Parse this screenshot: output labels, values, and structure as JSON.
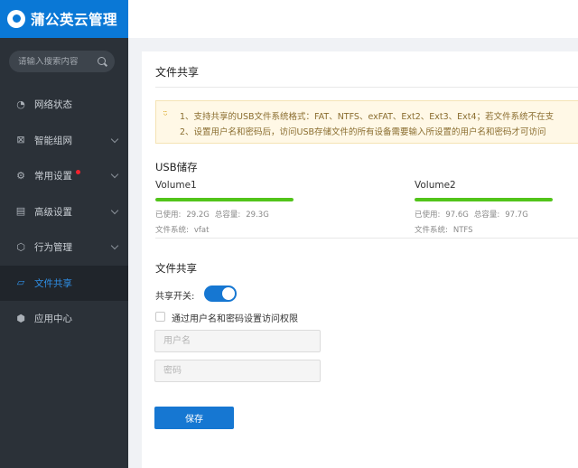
{
  "brand": {
    "title": "蒲公英云管理"
  },
  "search": {
    "placeholder": "请输入搜索内容"
  },
  "sidebar": {
    "items": [
      {
        "label": "网络状态",
        "icon": "gauge-icon"
      },
      {
        "label": "智能组网",
        "icon": "network-icon"
      },
      {
        "label": "常用设置",
        "icon": "gear-icon"
      },
      {
        "label": "高级设置",
        "icon": "document-icon"
      },
      {
        "label": "行为管理",
        "icon": "behavior-icon"
      },
      {
        "label": "文件共享",
        "icon": "folder-icon"
      },
      {
        "label": "应用中心",
        "icon": "cube-icon"
      }
    ]
  },
  "page": {
    "title": "文件共享"
  },
  "notice": {
    "line1": "1、支持共享的USB文件系统格式：FAT、NTFS、exFAT、Ext2、Ext3、Ext4；若文件系统不在支",
    "line2": "2、设置用户名和密码后，访问USB存储文件的所有设备需要输入所设置的用户名和密码才可访问"
  },
  "usb": {
    "title": "USB储存",
    "volumes": [
      {
        "name": "Volume1",
        "used_label": "已使用:",
        "used": "29.2G",
        "total_label": "总容量:",
        "total": "29.3G",
        "fs_label": "文件系统:",
        "fs": "vfat",
        "usage": 0.997
      },
      {
        "name": "Volume2",
        "used_label": "已使用:",
        "used": "97.6G",
        "total_label": "总容量:",
        "total": "97.7G",
        "fs_label": "文件系统:",
        "fs": "NTFS",
        "usage": 0.999
      }
    ]
  },
  "share": {
    "title": "文件共享",
    "switch_label": "共享开关:",
    "switch_on": true,
    "auth_label": "通过用户名和密码设置访问权限",
    "username_placeholder": "用户名",
    "password_placeholder": "密码",
    "save_label": "保存"
  },
  "colors": {
    "accent": "#1677d2",
    "progress": "#52c41a",
    "sidebar": "#2b3138",
    "brand": "#0a78d6"
  }
}
